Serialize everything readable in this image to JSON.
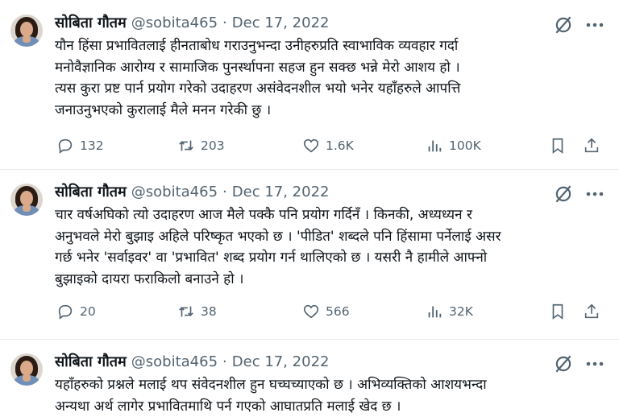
{
  "tweets": [
    {
      "name": "सोबिता गौतम",
      "handle": "@sobita465",
      "separator": "·",
      "date": "Dec 17, 2022",
      "text_lines": [
        "यौन हिंसा प्रभावितलाई हीनताबोध गराउनुभन्दा उनीहरुप्रति स्वाभाविक व्यवहार गर्दा",
        "मनोवैज्ञानिक आरोग्य र सामाजिक पुनर्स्थापना सहज हुन सक्छ भन्ने मेरो आशय हो ।",
        "त्यस कुरा प्रष्ट पार्न प्रयोग गरेको उदाहरण असंवेदनशील भयो भनेर यहाँहरुले आपत्ति",
        "जनाउनुभएको कुरालाई मैले मनन गरेकी छु ।"
      ],
      "replies": "132",
      "reposts": "203",
      "likes": "1.6K",
      "views": "100K"
    },
    {
      "name": "सोबिता गौतम",
      "handle": "@sobita465",
      "separator": "·",
      "date": "Dec 17, 2022",
      "text_lines": [
        "चार वर्षअघिको त्यो उदाहरण आज मैले पक्कै पनि प्रयोग गर्दिनँ । किनकी, अध्यध्यन र",
        "अनुभवले मेरो बुझाइ अहिले परिष्कृत भएको छ । 'पीडित' शब्दले पनि हिंसामा पर्नेलाई असर",
        "गर्छ भनेर 'सर्वाइवर' वा 'प्रभावित' शब्द प्रयोग गर्न थालिएको छ । यसरी नै हामीले आफ्नो",
        "बुझाइको दायरा फराकिलो बनाउने हो ।"
      ],
      "replies": "20",
      "reposts": "38",
      "likes": "566",
      "views": "32K"
    },
    {
      "name": "सोबिता गौतम",
      "handle": "@sobita465",
      "separator": "·",
      "date": "Dec 17, 2022",
      "text_lines": [
        "यहाँहरुको प्रश्नले मलाई थप संवेदनशील हुन घच्घच्याएको छ । अभिव्यक्तिको आशयभन्दा",
        "अन्यथा अर्थ लागेर प्रभावितमाथि पर्न गएको आघातप्रति मलाई खेद छ ।"
      ]
    }
  ],
  "colors": {
    "secondary": "#536471",
    "text": "#0f1419",
    "divider": "#e6ecf0"
  },
  "icons": [
    "avatar",
    "grok-icon",
    "more-icon",
    "reply-icon",
    "repost-icon",
    "like-icon",
    "views-icon",
    "bookmark-icon",
    "share-icon"
  ]
}
